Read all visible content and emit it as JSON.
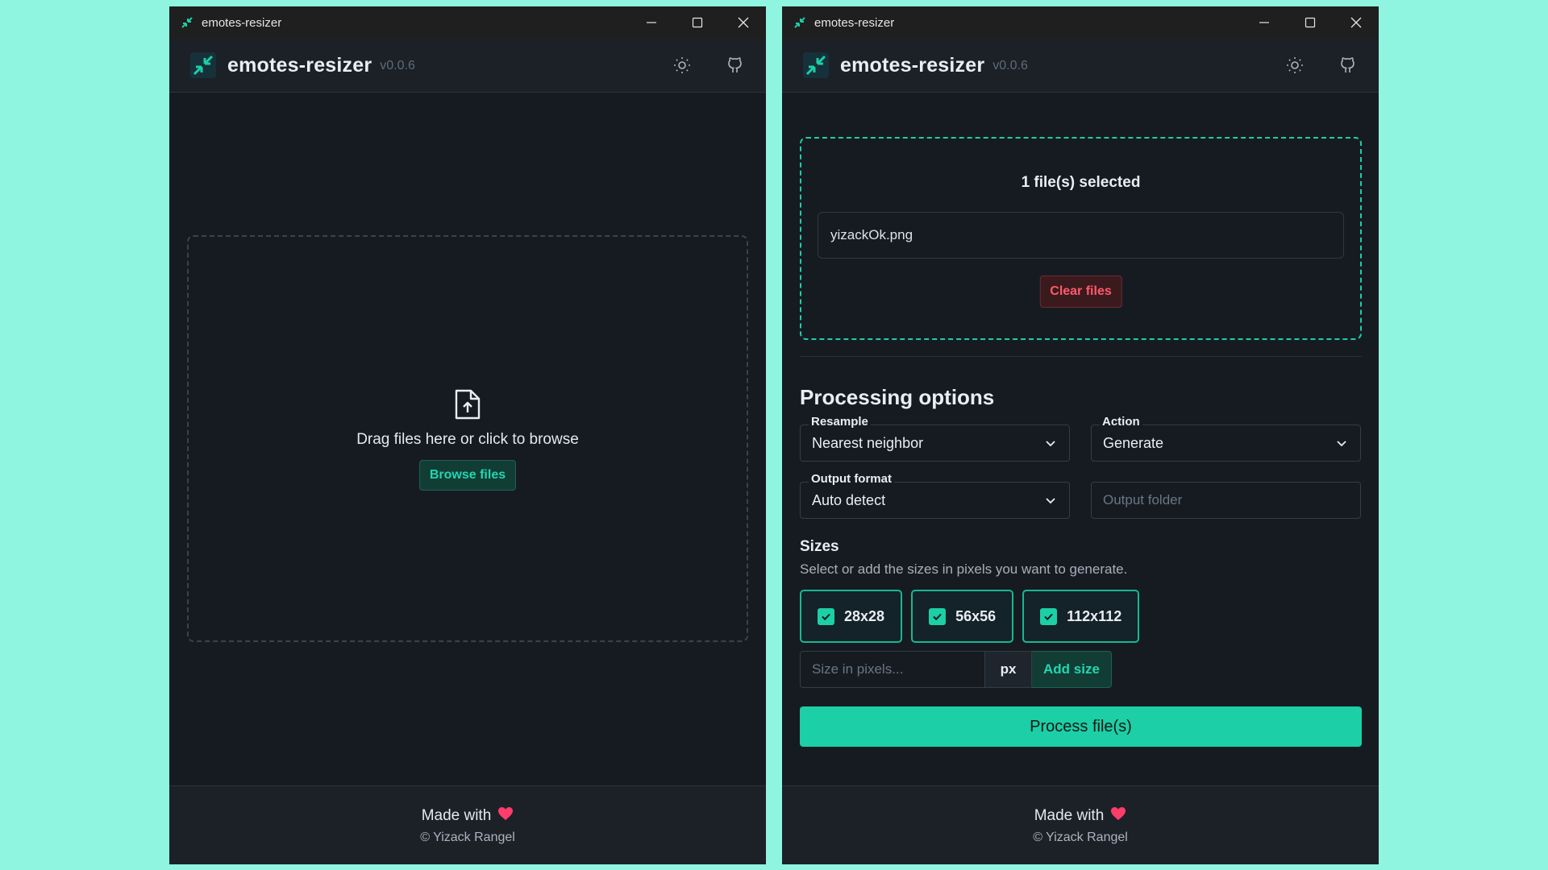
{
  "windows": [
    {
      "titlebar": {
        "title": "emotes-resizer"
      },
      "header": {
        "app_name": "emotes-resizer",
        "version": "v0.0.6"
      },
      "dropzone": {
        "text": "Drag files here or click to browse",
        "browse_label": "Browse files"
      },
      "footer": {
        "made_with": "Made with",
        "copyright": "© Yizack Rangel"
      }
    },
    {
      "titlebar": {
        "title": "emotes-resizer"
      },
      "header": {
        "app_name": "emotes-resizer",
        "version": "v0.0.6"
      },
      "selection": {
        "title": "1 file(s) selected",
        "files": [
          "yizackOk.png"
        ],
        "clear_label": "Clear files"
      },
      "options": {
        "title": "Processing options",
        "resample": {
          "label": "Resample",
          "value": "Nearest neighbor"
        },
        "action": {
          "label": "Action",
          "value": "Generate"
        },
        "output_format": {
          "label": "Output format",
          "value": "Auto detect"
        },
        "output_folder": {
          "placeholder": "Output folder"
        }
      },
      "sizes": {
        "title": "Sizes",
        "description": "Select or add the sizes in pixels you want to generate.",
        "items": [
          {
            "label": "28x28",
            "checked": true
          },
          {
            "label": "56x56",
            "checked": true
          },
          {
            "label": "112x112",
            "checked": true
          }
        ],
        "input_placeholder": "Size in pixels...",
        "unit": "px",
        "add_label": "Add size"
      },
      "process_label": "Process file(s)",
      "footer": {
        "made_with": "Made with",
        "copyright": "© Yizack Rangel"
      }
    }
  ],
  "colors": {
    "background": "#8ff5e0",
    "accent": "#1ccfa6",
    "danger": "#ff5a6b",
    "heart": "#ff3d6b"
  }
}
